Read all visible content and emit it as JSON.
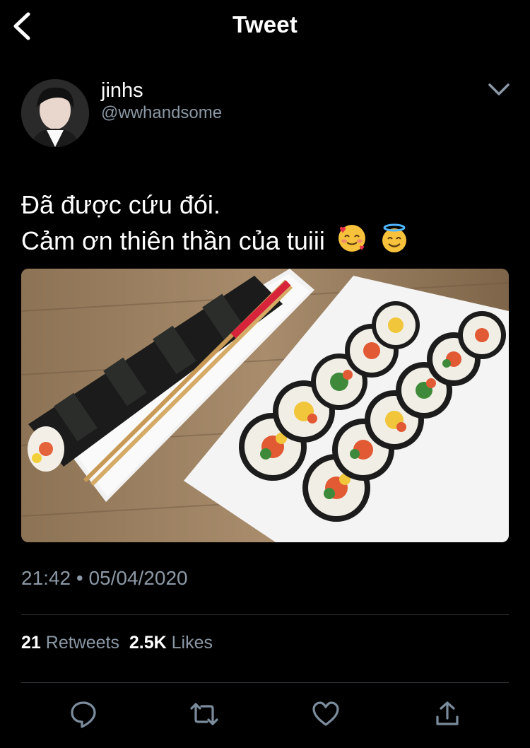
{
  "header": {
    "title": "Tweet"
  },
  "author": {
    "display_name": "jinhs",
    "handle": "@wwhandsome"
  },
  "tweet": {
    "line1": "Đã được cứu đói.",
    "line2": "Cảm ơn thiên thần của tuiii",
    "emojis": [
      "smiling-face-with-hearts",
      "smiling-face-with-halo"
    ]
  },
  "meta": {
    "time": "21:42",
    "separator": "•",
    "date": "05/04/2020"
  },
  "stats": {
    "retweets_count": "21",
    "retweets_label": "Retweets",
    "likes_count": "2.5K",
    "likes_label": "Likes"
  },
  "actions": [
    "reply-icon",
    "retweet-icon",
    "like-icon",
    "share-icon"
  ],
  "colors": {
    "background": "#000000",
    "text": "#ffffff",
    "secondary": "#8b98a5",
    "divider": "#2f3336",
    "icon": "#7b8c9c"
  }
}
